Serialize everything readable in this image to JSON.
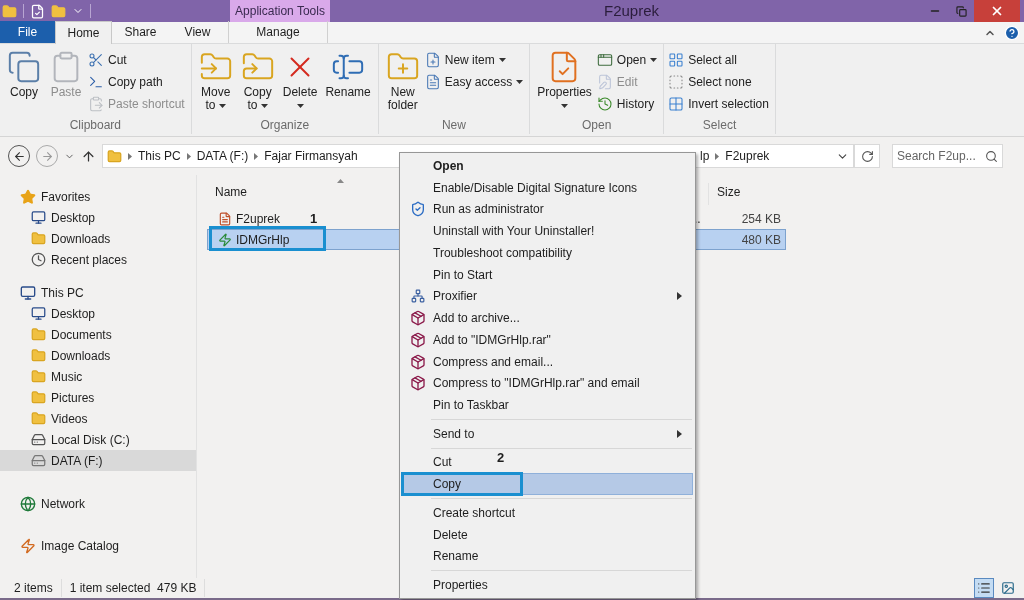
{
  "window": {
    "title": "F2uprek",
    "contextual_label": "Application Tools"
  },
  "tabs": [
    {
      "label": "File",
      "kind": "file",
      "selected": false
    },
    {
      "label": "Home",
      "kind": "tab",
      "selected": true
    },
    {
      "label": "Share",
      "kind": "tab",
      "selected": false
    },
    {
      "label": "View",
      "kind": "tab",
      "selected": false
    },
    {
      "label": "Manage",
      "kind": "contextual",
      "selected": false
    }
  ],
  "ribbon": [
    {
      "label": "Clipboard",
      "buttons": [
        {
          "label": "Copy",
          "kind": "large",
          "disabled": false,
          "dropdown": false
        },
        {
          "label": "Paste",
          "kind": "large",
          "disabled": true,
          "dropdown": false
        },
        {
          "label": "Cut",
          "kind": "small",
          "disabled": false,
          "dropdown": false
        },
        {
          "label": "Copy path",
          "kind": "small",
          "disabled": false,
          "dropdown": false
        },
        {
          "label": "Paste shortcut",
          "kind": "small",
          "disabled": true,
          "dropdown": false
        }
      ]
    },
    {
      "label": "Organize",
      "buttons": [
        {
          "label": "Move to",
          "kind": "large",
          "disabled": false,
          "dropdown": true
        },
        {
          "label": "Copy to",
          "kind": "large",
          "disabled": false,
          "dropdown": true
        },
        {
          "label": "Delete",
          "kind": "large",
          "disabled": false,
          "dropdown": true
        },
        {
          "label": "Rename",
          "kind": "large",
          "disabled": false,
          "dropdown": false
        }
      ]
    },
    {
      "label": "New",
      "buttons": [
        {
          "label": "New folder",
          "kind": "large",
          "disabled": false,
          "dropdown": false
        },
        {
          "label": "New item",
          "kind": "small",
          "disabled": false,
          "dropdown": true
        },
        {
          "label": "Easy access",
          "kind": "small",
          "disabled": false,
          "dropdown": true
        }
      ]
    },
    {
      "label": "Open",
      "buttons": [
        {
          "label": "Properties",
          "kind": "large",
          "disabled": false,
          "dropdown": true
        },
        {
          "label": "Open",
          "kind": "small",
          "disabled": false,
          "dropdown": true
        },
        {
          "label": "Edit",
          "kind": "small",
          "disabled": true,
          "dropdown": false
        },
        {
          "label": "History",
          "kind": "small",
          "disabled": false,
          "dropdown": false
        }
      ]
    },
    {
      "label": "Select",
      "buttons": [
        {
          "label": "Select all",
          "kind": "small",
          "disabled": false,
          "dropdown": false
        },
        {
          "label": "Select none",
          "kind": "small",
          "disabled": false,
          "dropdown": false
        },
        {
          "label": "Invert selection",
          "kind": "small",
          "disabled": false,
          "dropdown": false
        }
      ]
    }
  ],
  "address": {
    "segments": [
      "This PC",
      "DATA (F:)",
      "Fajar Firmansyah",
      "lp",
      "F2uprek"
    ],
    "search_placeholder": "Search F2up..."
  },
  "sidebar": [
    {
      "label": "Favorites",
      "selected": false,
      "children": [
        {
          "label": "Desktop",
          "selected": false
        },
        {
          "label": "Downloads",
          "selected": false
        },
        {
          "label": "Recent places",
          "selected": false
        }
      ]
    },
    {
      "label": "This PC",
      "selected": false,
      "children": [
        {
          "label": "Desktop",
          "selected": false
        },
        {
          "label": "Documents",
          "selected": false
        },
        {
          "label": "Downloads",
          "selected": false
        },
        {
          "label": "Music",
          "selected": false
        },
        {
          "label": "Pictures",
          "selected": false
        },
        {
          "label": "Videos",
          "selected": false
        },
        {
          "label": "Local Disk (C:)",
          "selected": false
        },
        {
          "label": "DATA (F:)",
          "selected": true
        }
      ]
    },
    {
      "label": "Network",
      "selected": false
    },
    {
      "label": "Image Catalog",
      "selected": false
    }
  ],
  "table": {
    "columns": [
      "Name",
      "Size"
    ],
    "rows": [
      {
        "name": "F2uprek",
        "column_2": "..",
        "size": "254 KB",
        "selected": false,
        "annotation": "1"
      },
      {
        "name": "IDMGrHlp",
        "size": "480 KB",
        "selected": true
      }
    ]
  },
  "context_menu": [
    {
      "kind": "item",
      "label": "Open",
      "default": true,
      "selected": false,
      "submenu": false
    },
    {
      "kind": "item",
      "label": "Enable/Disable Digital Signature Icons",
      "default": false,
      "selected": false,
      "submenu": false
    },
    {
      "kind": "item",
      "label": "Run as administrator",
      "default": false,
      "selected": false,
      "submenu": false
    },
    {
      "kind": "item",
      "label": "Uninstall with Your Uninstaller!",
      "default": false,
      "selected": false,
      "submenu": false
    },
    {
      "kind": "item",
      "label": "Troubleshoot compatibility",
      "default": false,
      "selected": false,
      "submenu": false
    },
    {
      "kind": "item",
      "label": "Pin to Start",
      "default": false,
      "selected": false,
      "submenu": false
    },
    {
      "kind": "item",
      "label": "Proxifier",
      "default": false,
      "selected": false,
      "submenu": true
    },
    {
      "kind": "item",
      "label": "Add to archive...",
      "default": false,
      "selected": false,
      "submenu": false
    },
    {
      "kind": "item",
      "label": "Add to \"IDMGrHlp.rar\"",
      "default": false,
      "selected": false,
      "submenu": false
    },
    {
      "kind": "item",
      "label": "Compress and email...",
      "default": false,
      "selected": false,
      "submenu": false
    },
    {
      "kind": "item",
      "label": "Compress to \"IDMGrHlp.rar\" and email",
      "default": false,
      "selected": false,
      "submenu": false
    },
    {
      "kind": "item",
      "label": "Pin to Taskbar",
      "default": false,
      "selected": false,
      "submenu": false
    },
    {
      "kind": "separator"
    },
    {
      "kind": "item",
      "label": "Send to",
      "default": false,
      "selected": false,
      "submenu": true
    },
    {
      "kind": "separator"
    },
    {
      "kind": "item",
      "label": "Cut",
      "default": false,
      "selected": false,
      "submenu": false,
      "annotation": "2"
    },
    {
      "kind": "item",
      "label": "Copy",
      "default": false,
      "selected": true,
      "submenu": false
    },
    {
      "kind": "separator"
    },
    {
      "kind": "item",
      "label": "Create shortcut",
      "default": false,
      "selected": false,
      "submenu": false
    },
    {
      "kind": "item",
      "label": "Delete",
      "default": false,
      "selected": false,
      "submenu": false
    },
    {
      "kind": "item",
      "label": "Rename",
      "default": false,
      "selected": false,
      "submenu": false
    },
    {
      "kind": "separator"
    },
    {
      "kind": "item",
      "label": "Properties",
      "default": false,
      "selected": false,
      "submenu": false
    }
  ],
  "status_bar": {
    "items": "2 items",
    "selection": "1 item selected  479 KB",
    "views": [
      {
        "kind": "details",
        "selected": true
      },
      {
        "kind": "large_icons",
        "selected": false
      }
    ]
  }
}
